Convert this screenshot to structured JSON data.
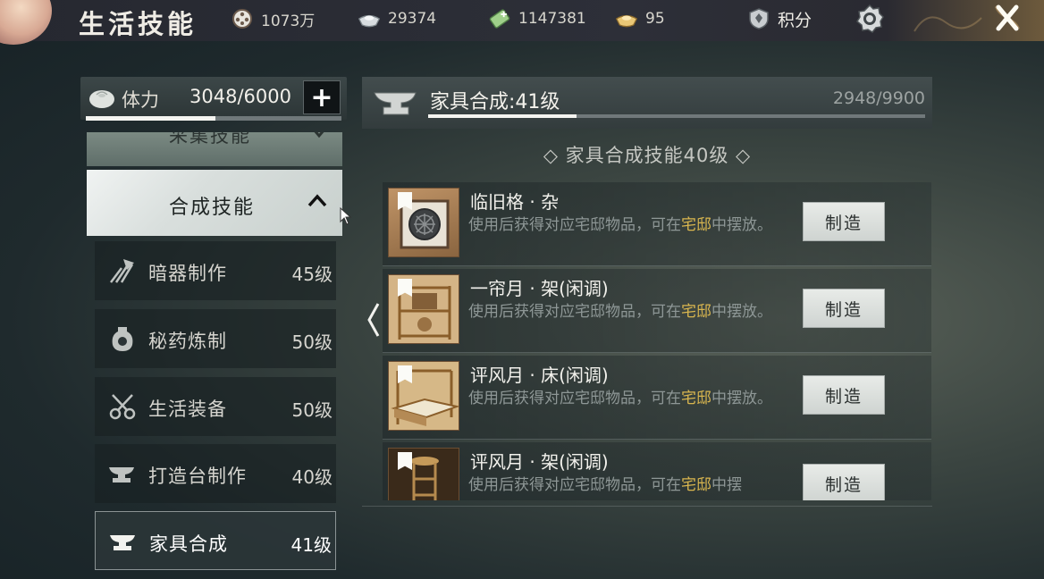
{
  "topbar": {
    "title": "生活技能",
    "resources": [
      {
        "icon": "coin-reel-icon",
        "value": "1073万"
      },
      {
        "icon": "silver-ingot-icon",
        "value": "29374"
      },
      {
        "icon": "green-ticket-icon",
        "value": "1147381"
      },
      {
        "icon": "gold-ingot-icon",
        "value": "95"
      }
    ],
    "points_label": "积分",
    "close_label": "✕"
  },
  "stamina": {
    "label": "体力",
    "value": "3048/6000",
    "add_label": "+",
    "fraction": 0.508
  },
  "sidebar": {
    "collapsed_category": "采集技能",
    "open_category": "合成技能",
    "skills": [
      {
        "name": "暗器制作",
        "level": "45级",
        "icon": "dart-icon"
      },
      {
        "name": "秘药炼制",
        "level": "50级",
        "icon": "potion-jar-icon"
      },
      {
        "name": "生活装备",
        "level": "50级",
        "icon": "scissors-icon"
      },
      {
        "name": "打造台制作",
        "level": "40级",
        "icon": "anvil-icon"
      },
      {
        "name": "家具合成",
        "level": "41级",
        "icon": "anvil-icon",
        "active": true
      }
    ]
  },
  "main": {
    "title": "家具合成:41级",
    "exp": "2948/9900",
    "exp_fraction": 0.298,
    "section_label": "◇ 家具合成技能40级 ◇",
    "items": [
      {
        "name": "临旧格 · 杂",
        "desc_pre": "使用后获得对应宅邸物品，可在",
        "desc_hl": "宅邸",
        "desc_post": "中摆放。",
        "button": "制造"
      },
      {
        "name": "一帘月 · 架(闲调)",
        "desc_pre": "使用后获得对应宅邸物品，可在",
        "desc_hl": "宅邸",
        "desc_post": "中摆放。",
        "button": "制造"
      },
      {
        "name": "评风月 · 床(闲调)",
        "desc_pre": "使用后获得对应宅邸物品，可在",
        "desc_hl": "宅邸",
        "desc_post": "中摆放。",
        "button": "制造"
      },
      {
        "name": "评风月 · 架(闲调)",
        "desc_pre": "使用后获得对应宅邸物品，可在",
        "desc_hl": "宅邸",
        "desc_post": "中摆",
        "button": "制造"
      }
    ]
  },
  "colors": {
    "highlight": "#d9b64f",
    "accent_light": "#f4f4f0"
  }
}
